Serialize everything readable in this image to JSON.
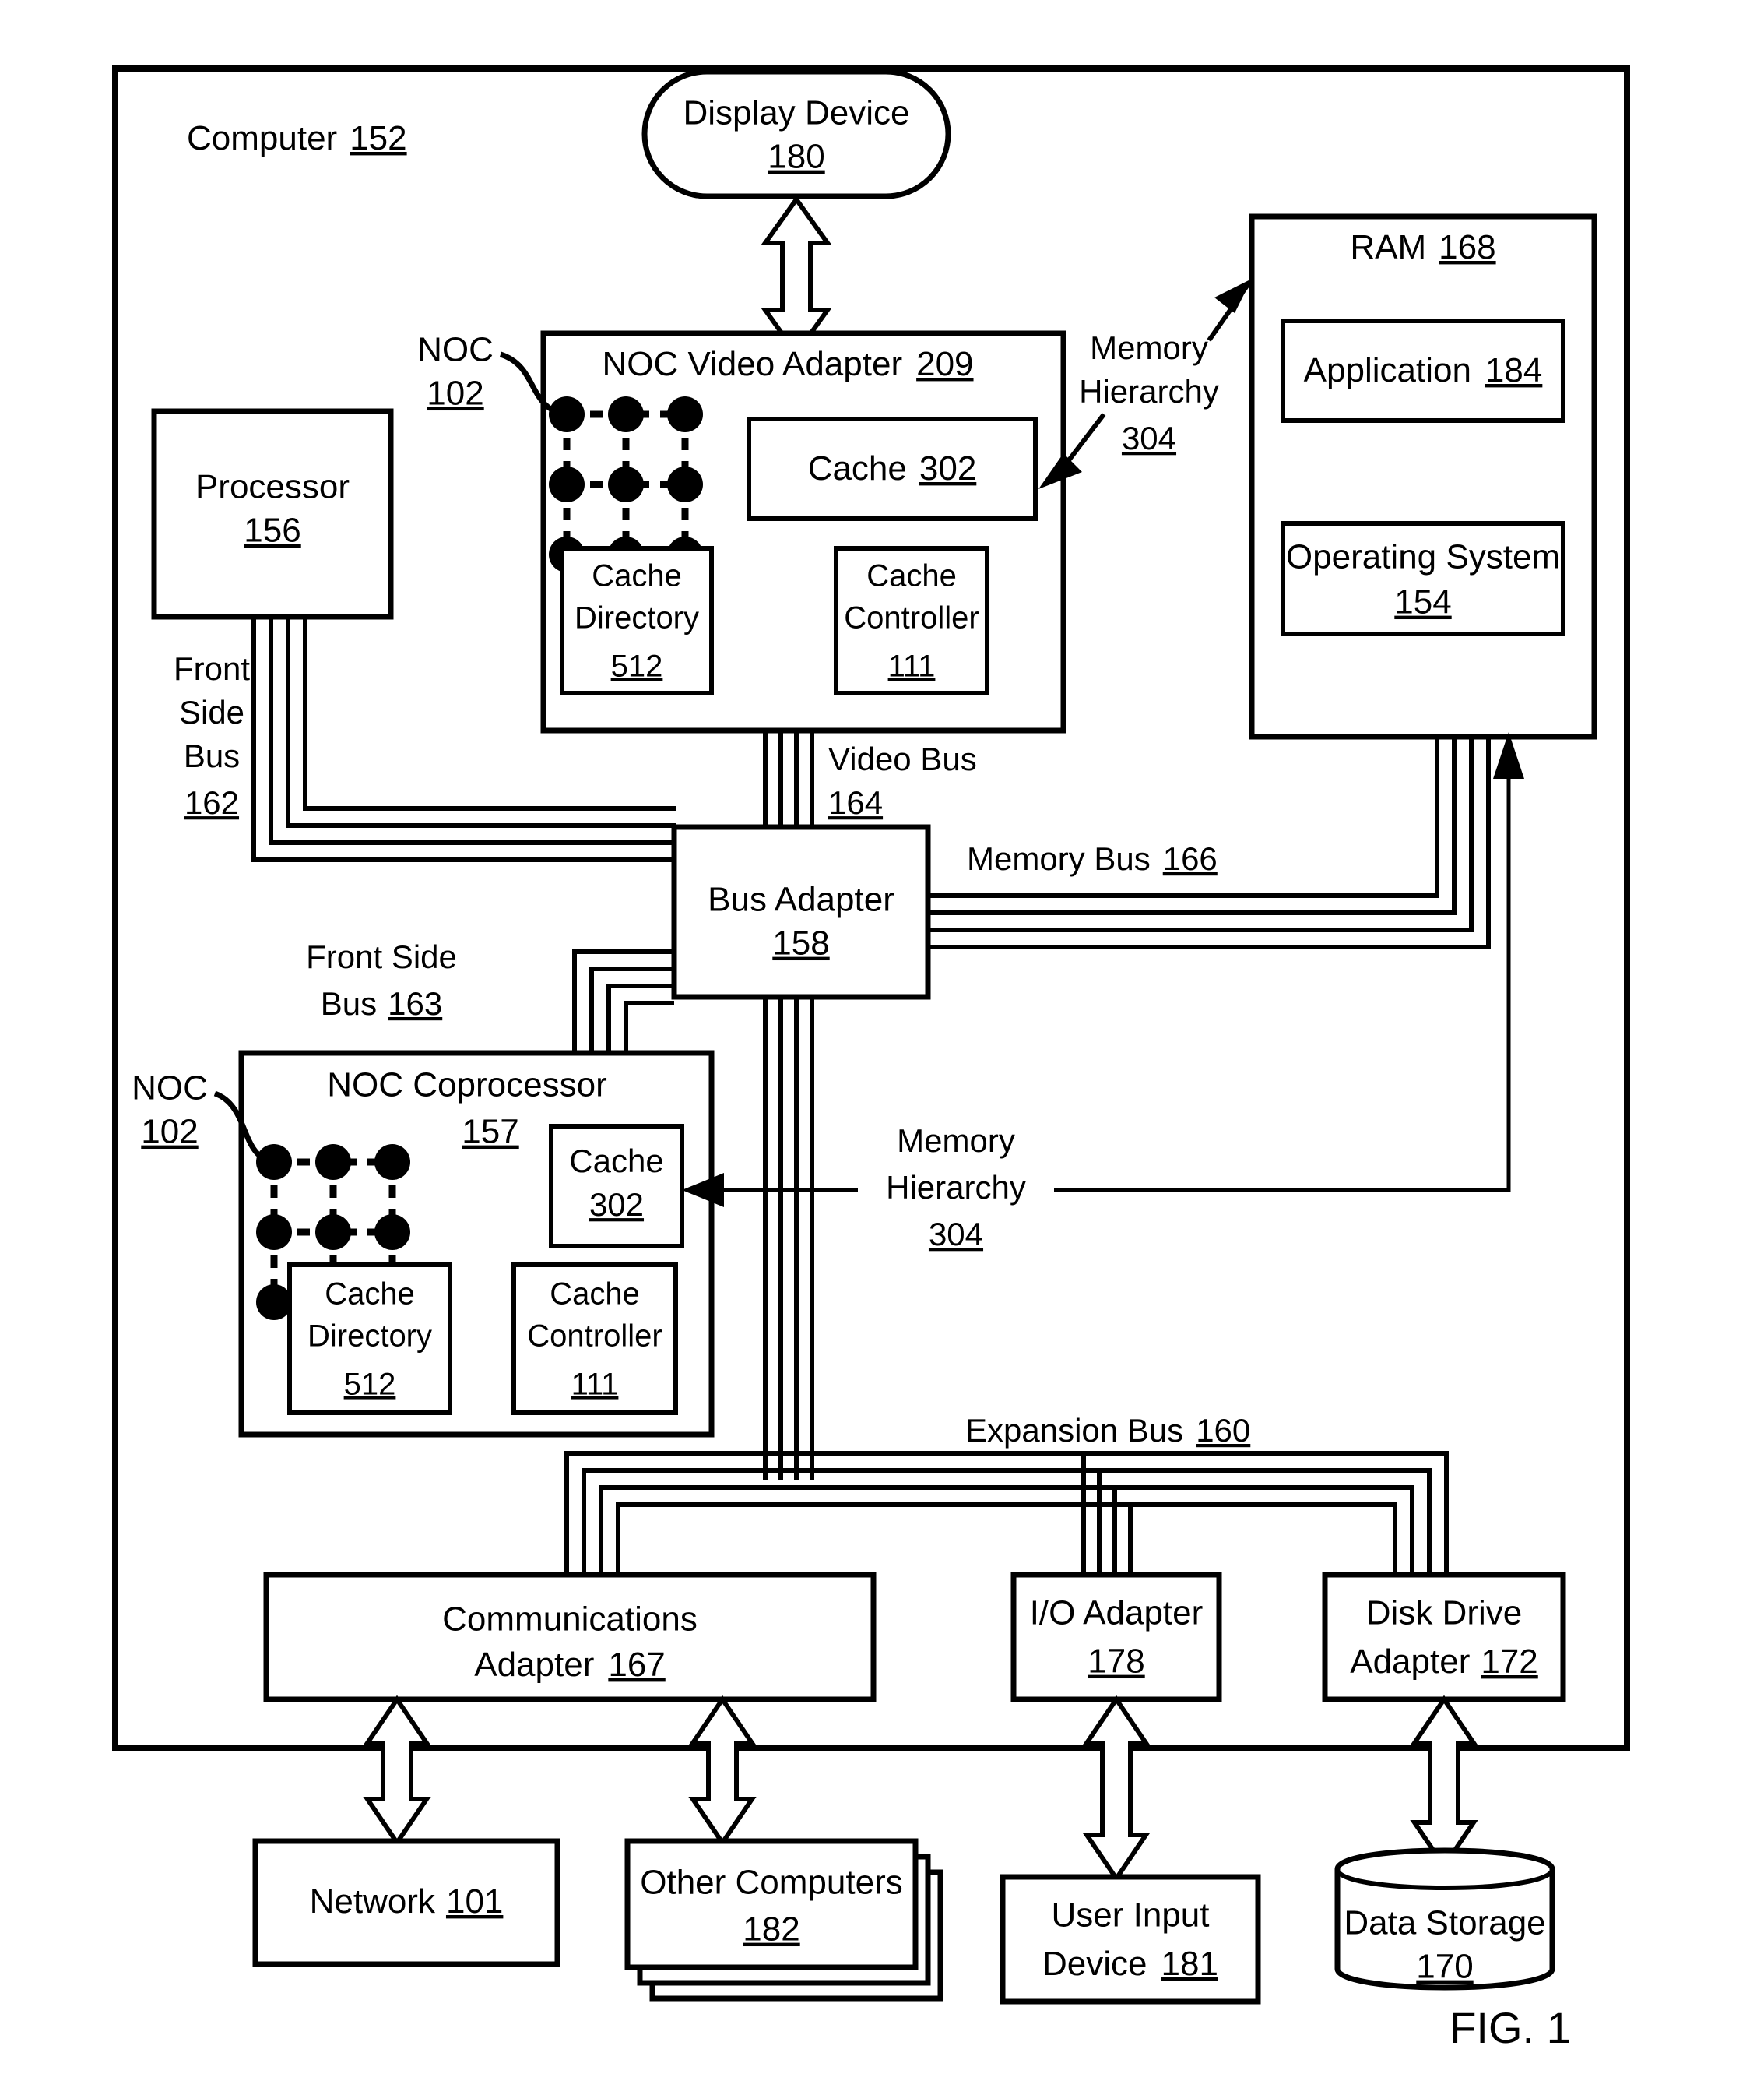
{
  "figure": {
    "caption": "FIG. 1",
    "outer_label": "Computer",
    "outer_ref": "152"
  },
  "blocks": {
    "display_device": {
      "label": "Display Device",
      "ref": "180"
    },
    "ram": {
      "label": "RAM",
      "ref": "168"
    },
    "application": {
      "label": "Application",
      "ref": "184"
    },
    "operating_system": {
      "label": "Operating System",
      "ref": "154"
    },
    "processor": {
      "label": "Processor",
      "ref": "156"
    },
    "noc_video_adapter": {
      "label": "NOC Video Adapter",
      "ref": "209"
    },
    "video_cache": {
      "label": "Cache",
      "ref": "302"
    },
    "video_cache_directory": {
      "label_line1": "Cache",
      "label_line2": "Directory",
      "ref": "512"
    },
    "video_cache_controller": {
      "label_line1": "Cache",
      "label_line2": "Controller",
      "ref": "111"
    },
    "bus_adapter": {
      "label": "Bus Adapter",
      "ref": "158"
    },
    "noc_coprocessor": {
      "label": "NOC Coprocessor",
      "ref": "157"
    },
    "copro_cache": {
      "label": "Cache",
      "ref": "302"
    },
    "copro_cache_directory": {
      "label_line1": "Cache",
      "label_line2": "Directory",
      "ref": "512"
    },
    "copro_cache_controller": {
      "label_line1": "Cache",
      "label_line2": "Controller",
      "ref": "111"
    },
    "communications_adapter": {
      "label_line1": "Communications",
      "label_line2": "Adapter",
      "ref": "167"
    },
    "io_adapter": {
      "label": "I/O Adapter",
      "ref": "178"
    },
    "disk_drive_adapter": {
      "label_line1": "Disk Drive",
      "label_line2": "Adapter",
      "ref": "172"
    },
    "network": {
      "label": "Network",
      "ref": "101"
    },
    "other_computers": {
      "label": "Other Computers",
      "ref": "182"
    },
    "user_input_device": {
      "label_line1": "User Input",
      "label_line2": "Device",
      "ref": "181"
    },
    "data_storage": {
      "label": "Data Storage",
      "ref": "170"
    }
  },
  "labels": {
    "noc_top": {
      "label": "NOC",
      "ref": "102"
    },
    "noc_bottom": {
      "label": "NOC",
      "ref": "102"
    },
    "memory_hierarchy_top": {
      "line1": "Memory",
      "line2": "Hierarchy",
      "ref": "304"
    },
    "memory_hierarchy_bottom": {
      "line1": "Memory",
      "line2": "Hierarchy",
      "ref": "304"
    },
    "front_side_bus_162": {
      "line1": "Front",
      "line2": "Side",
      "line3": "Bus",
      "ref": "162"
    },
    "front_side_bus_163": {
      "line1": "Front Side",
      "line2": "Bus",
      "ref": "163"
    },
    "video_bus": {
      "line1": "Video Bus",
      "ref": "164"
    },
    "memory_bus": {
      "label": "Memory Bus",
      "ref": "166"
    },
    "expansion_bus": {
      "label": "Expansion Bus",
      "ref": "160"
    }
  }
}
